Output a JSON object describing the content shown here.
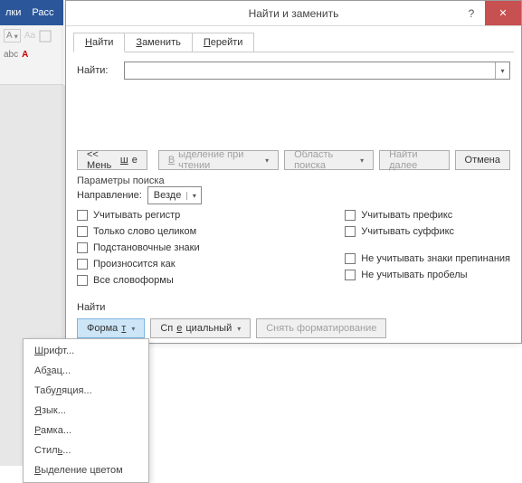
{
  "ribbon": {
    "tab1": "лки",
    "tab2": "Расс",
    "fontName": "Aa",
    "abc": "abc"
  },
  "dialog": {
    "title": "Найти и заменить",
    "help": "?",
    "close": "✕",
    "tabs": {
      "find_u": "Н",
      "find_rest": "айти",
      "replace_u": "З",
      "replace_rest": "аменить",
      "goto_u": "П",
      "goto_rest": "ерейти"
    },
    "findLabel": "Найт",
    "findLabel_u": "и",
    "findLabel_colon": ":",
    "lessBtn": "<< Мень",
    "lessBtn_u": "ш",
    "lessBtn_rest": "е",
    "highlightBtn_u": "В",
    "highlightBtn_rest": "ыделение при чтении",
    "searchInBtn": "Область поиска",
    "findNextBtn": "Найти далее",
    "cancelBtn": "Отмена",
    "optionsLabel": "Параметры поиска",
    "directionLabel": "Направление:",
    "directionValue": "Везде",
    "chk": {
      "matchCase": "Учитывать регистр",
      "wholeWord": "Только слово целиком",
      "wildcards": "Подстановочные знаки",
      "soundsLike": "Произносится как",
      "wordForms": "Все словоформы",
      "prefix": "Учитывать префикс",
      "suffix_pre": "У",
      "suffix_u": "ч",
      "suffix_rest": "итывать суффикс",
      "ignorePunct_pre": "Не у",
      "ignorePunct_u": "ч",
      "ignorePunct_rest": "итывать знаки препинания",
      "ignoreSpace_pre": "Не учитывать про",
      "ignoreSpace_u": "б",
      "ignoreSpace_rest": "елы"
    },
    "findSectionLabel": "Найти",
    "formatBtn": "Форма",
    "formatBtn_u": "т",
    "specialBtn": "Сп",
    "specialBtn_u": "е",
    "specialBtn_rest": "циальный",
    "clearFmtBtn": "Снять форматирование"
  },
  "menu": {
    "font_u": "Ш",
    "font_rest": "рифт...",
    "para_pre": "Аб",
    "para_u": "з",
    "para_rest": "ац...",
    "tabs_pre": "Табу",
    "tabs_u": "л",
    "tabs_rest": "яция...",
    "lang_u": "Я",
    "lang_rest": "зык...",
    "frame_u": "Р",
    "frame_rest": "амка...",
    "style_pre": "Стил",
    "style_u": "ь",
    "style_rest": "...",
    "highlight_u": "В",
    "highlight_rest": "ыделение цветом"
  }
}
